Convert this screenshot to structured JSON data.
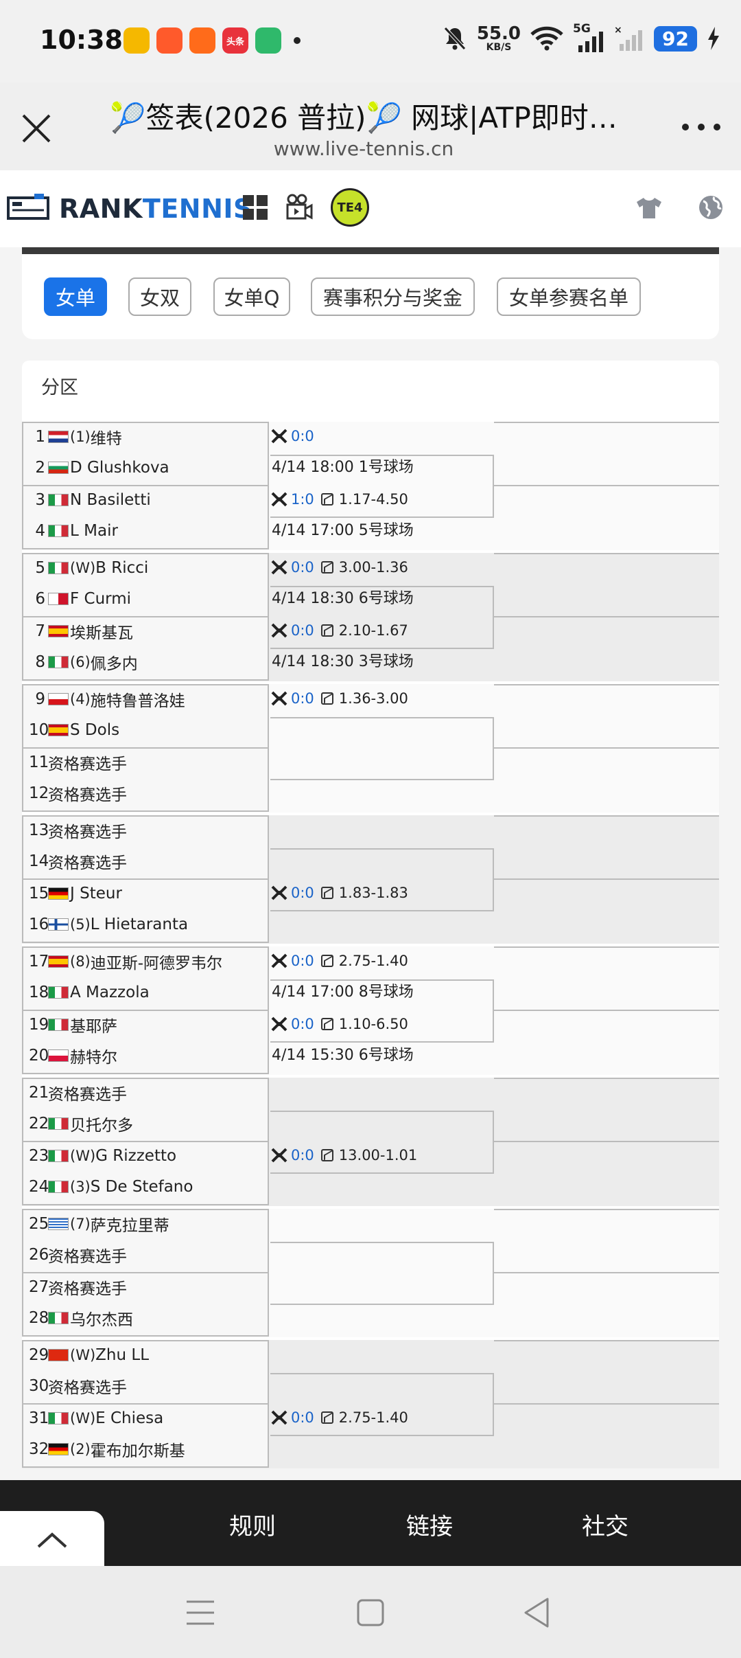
{
  "status_bar": {
    "time": "10:38",
    "apps": [
      {
        "name": "weibo-app-icon",
        "label": "",
        "color": "#f5b800"
      },
      {
        "name": "app-icon-2",
        "label": "",
        "color": "#ff5a2b"
      },
      {
        "name": "app-icon-3",
        "label": "",
        "color": "#ff6b1a"
      },
      {
        "name": "toutiao-app-icon",
        "label": "头条",
        "color": "#e8323c"
      },
      {
        "name": "video-app-icon",
        "label": "",
        "color": "#2fb96b"
      }
    ],
    "speed_value": "55.0",
    "speed_unit": "KB/S",
    "network": "5G",
    "battery": "92"
  },
  "browser": {
    "title": "🎾签表(2026 普拉)🎾 网球|ATP即时…",
    "url": "www.live-tennis.cn"
  },
  "site": {
    "logo_part1": "RANK",
    "logo_part2": "TENNIS",
    "te4_label": "TE4"
  },
  "tabs": [
    {
      "label": "女单",
      "active": true
    },
    {
      "label": "女双",
      "active": false
    },
    {
      "label": "女单Q",
      "active": false
    },
    {
      "label": "赛事积分与奖金",
      "active": false
    },
    {
      "label": "女单参赛名单",
      "active": false
    }
  ],
  "draw": {
    "section_label": "分区",
    "players": [
      {
        "num": "1",
        "flag": "hr",
        "seed": "(1)",
        "name": "维特"
      },
      {
        "num": "2",
        "flag": "bg",
        "seed": "",
        "name": "D Glushkova"
      },
      {
        "num": "3",
        "flag": "it",
        "seed": "",
        "name": "N Basiletti"
      },
      {
        "num": "4",
        "flag": "it",
        "seed": "",
        "name": "L Mair"
      },
      {
        "num": "5",
        "flag": "it",
        "seed": "(W)",
        "name": " B Ricci"
      },
      {
        "num": "6",
        "flag": "mt",
        "seed": "",
        "name": "F Curmi"
      },
      {
        "num": "7",
        "flag": "es",
        "seed": "",
        "name": "埃斯基瓦"
      },
      {
        "num": "8",
        "flag": "it",
        "seed": "(6)",
        "name": "佩多内"
      },
      {
        "num": "9",
        "flag": "cz",
        "seed": "(4)",
        "name": "施特鲁普洛娃"
      },
      {
        "num": "10",
        "flag": "es",
        "seed": "",
        "name": "S Dols"
      },
      {
        "num": "11",
        "flag": "",
        "seed": "",
        "name": "资格赛选手"
      },
      {
        "num": "12",
        "flag": "",
        "seed": "",
        "name": "资格赛选手"
      },
      {
        "num": "13",
        "flag": "",
        "seed": "",
        "name": "资格赛选手"
      },
      {
        "num": "14",
        "flag": "",
        "seed": "",
        "name": "资格赛选手"
      },
      {
        "num": "15",
        "flag": "de",
        "seed": "",
        "name": "J Steur"
      },
      {
        "num": "16",
        "flag": "fi",
        "seed": "(5)",
        "name": " L Hietaranta"
      },
      {
        "num": "17",
        "flag": "es",
        "seed": "(8)",
        "name": "迪亚斯-阿德罗韦尔"
      },
      {
        "num": "18",
        "flag": "it",
        "seed": "",
        "name": "A Mazzola"
      },
      {
        "num": "19",
        "flag": "it",
        "seed": "",
        "name": "基耶萨"
      },
      {
        "num": "20",
        "flag": "pl",
        "seed": "",
        "name": "赫特尔"
      },
      {
        "num": "21",
        "flag": "",
        "seed": "",
        "name": "资格赛选手"
      },
      {
        "num": "22",
        "flag": "it",
        "seed": "",
        "name": "贝托尔多"
      },
      {
        "num": "23",
        "flag": "it",
        "seed": "(W)",
        "name": " G Rizzetto"
      },
      {
        "num": "24",
        "flag": "it",
        "seed": "(3)",
        "name": " S De Stefano"
      },
      {
        "num": "25",
        "flag": "gr",
        "seed": "(7)",
        "name": "萨克拉里蒂"
      },
      {
        "num": "26",
        "flag": "",
        "seed": "",
        "name": "资格赛选手"
      },
      {
        "num": "27",
        "flag": "",
        "seed": "",
        "name": "资格赛选手"
      },
      {
        "num": "28",
        "flag": "it",
        "seed": "",
        "name": "乌尔杰西"
      },
      {
        "num": "29",
        "flag": "cn",
        "seed": "(W)",
        "name": " Zhu LL"
      },
      {
        "num": "30",
        "flag": "",
        "seed": "",
        "name": "资格赛选手"
      },
      {
        "num": "31",
        "flag": "it",
        "seed": "(W)",
        "name": " E Chiesa"
      },
      {
        "num": "32",
        "flag": "de",
        "seed": "(2)",
        "name": "霍布加尔斯基"
      }
    ],
    "matches": [
      {
        "match": 1,
        "score": "0:0",
        "odds": "",
        "info": "4/14 18:00 1号球场"
      },
      {
        "match": 2,
        "score": "1:0",
        "odds": "1.17-4.50",
        "info": "4/14 17:00 5号球场"
      },
      {
        "match": 3,
        "score": "0:0",
        "odds": "3.00-1.36",
        "info": "4/14 18:30 6号球场"
      },
      {
        "match": 4,
        "score": "0:0",
        "odds": "2.10-1.67",
        "info": "4/14 18:30 3号球场"
      },
      {
        "match": 5,
        "score": "0:0",
        "odds": "1.36-3.00",
        "info": ""
      },
      {
        "match": 8,
        "score": "0:0",
        "odds": "1.83-1.83",
        "info": ""
      },
      {
        "match": 9,
        "score": "0:0",
        "odds": "2.75-1.40",
        "info": "4/14 17:00 8号球场"
      },
      {
        "match": 10,
        "score": "0:0",
        "odds": "1.10-6.50",
        "info": "4/14 15:30 6号球场"
      },
      {
        "match": 12,
        "score": "0:0",
        "odds": "13.00-1.01",
        "info": ""
      },
      {
        "match": 16,
        "score": "0:0",
        "odds": "2.75-1.40",
        "info": ""
      }
    ]
  },
  "footer": {
    "links": [
      "规则",
      "链接",
      "社交"
    ]
  },
  "colors": {
    "accent": "#1a73e8",
    "score": "#1a63c8",
    "footer_bg": "#1e1e1e"
  }
}
